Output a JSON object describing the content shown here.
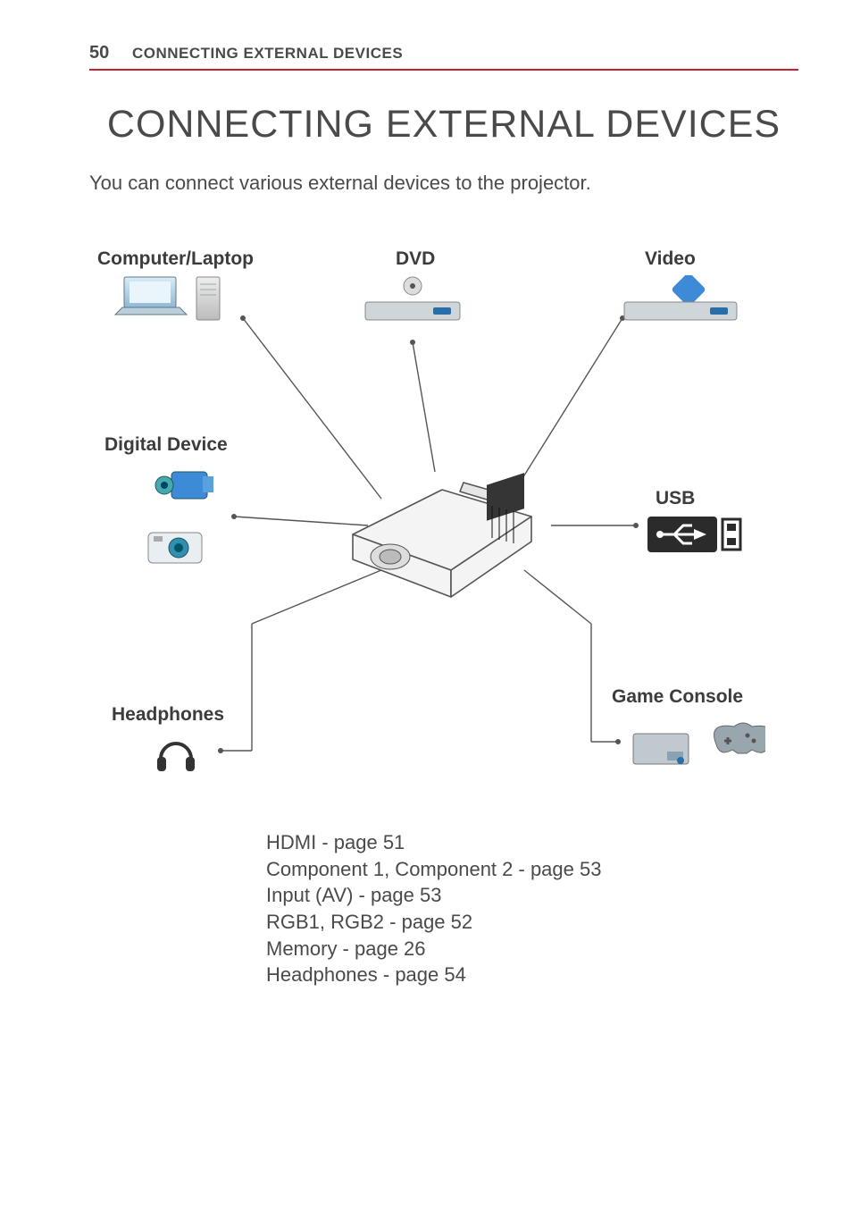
{
  "header": {
    "page_number": "50",
    "section_title": "CONNECTING EXTERNAL DEVICES"
  },
  "title": "CONNECTING EXTERNAL DEVICES",
  "intro": "You can connect various external devices to the projector.",
  "diagram_labels": {
    "computer": "Computer/Laptop",
    "dvd": "DVD",
    "video": "Video",
    "digital": "Digital Device",
    "usb": "USB",
    "headphones": "Headphones",
    "game": "Game Console"
  },
  "reference_lines": [
    "HDMI - page 51",
    "Component 1, Component 2 - page 53",
    "Input (AV) - page 53",
    "RGB1, RGB2 - page 52",
    "Memory - page 26",
    "Headphones - page 54"
  ]
}
